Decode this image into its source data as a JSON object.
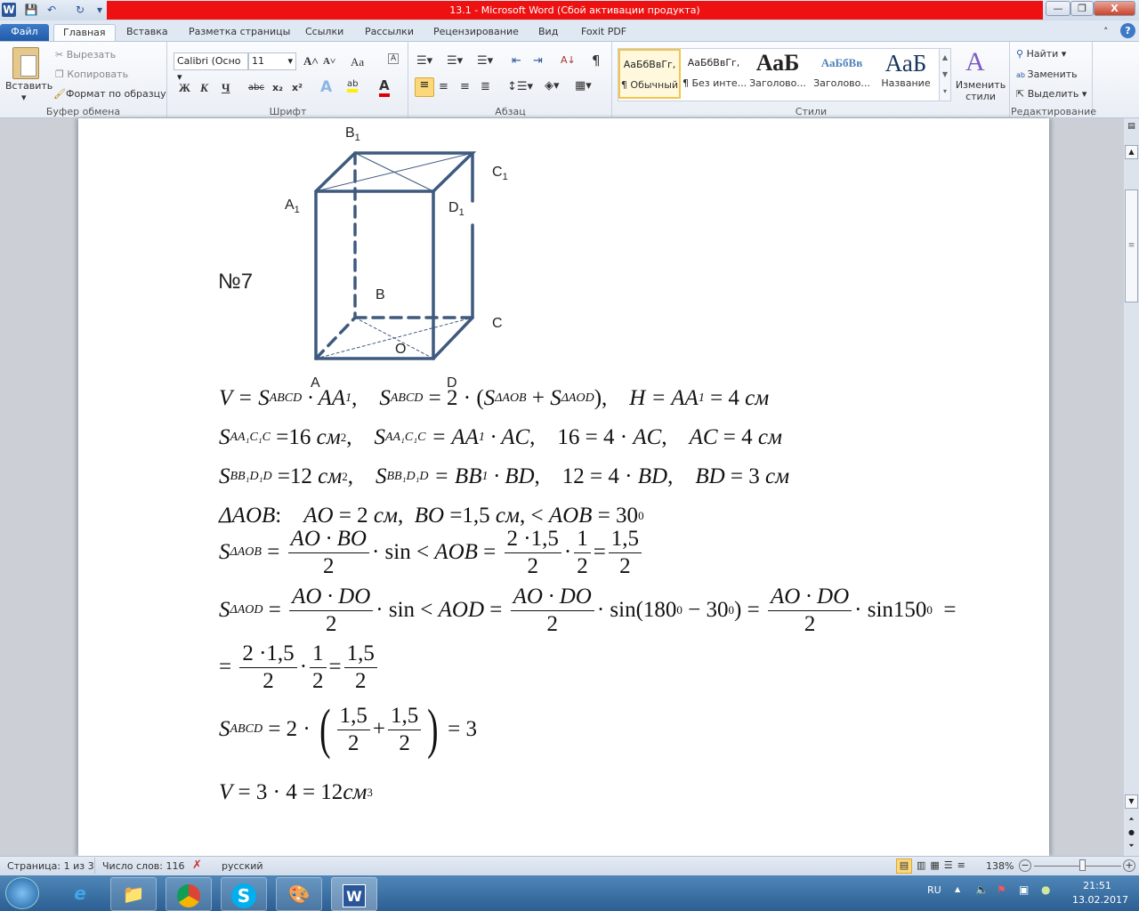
{
  "window": {
    "title": "13.1  -  Microsoft Word (Сбой активации продукта)",
    "minimize": "—",
    "restore": "❐",
    "close": "X"
  },
  "quick_access": {
    "word_icon": "W",
    "save": "💾",
    "undo": "↶",
    "redo": "↻",
    "customize": "▾"
  },
  "tabs": [
    "Файл",
    "Главная",
    "Вставка",
    "Разметка страницы",
    "Ссылки",
    "Рассылки",
    "Рецензирование",
    "Вид",
    "Foxit PDF"
  ],
  "ribbon": {
    "clipboard": {
      "paste": "Вставить",
      "cut": "Вырезать",
      "copy": "Копировать",
      "format_painter": "Формат по образцу",
      "label": "Буфер обмена"
    },
    "font": {
      "font_name": "Calibri (Осно",
      "font_size": "11",
      "grow": "A˄",
      "shrink": "A˅",
      "case": "Aa",
      "clear": "A",
      "bold": "Ж",
      "italic": "К",
      "underline": "Ч",
      "strike": "abc",
      "subscript": "x₂",
      "superscript": "x²",
      "effects": "A",
      "highlight": "ab",
      "color": "A",
      "label": "Шрифт"
    },
    "paragraph": {
      "label": "Абзац",
      "pilcrow": "¶",
      "sort": "А↓"
    },
    "styles": {
      "items": [
        {
          "preview": "АаБбВвГг,",
          "name": "¶ Обычный"
        },
        {
          "preview": "АаБбВвГг,",
          "name": "¶ Без инте..."
        },
        {
          "preview": "АаБ",
          "name": "Заголово..."
        },
        {
          "preview": "АаБбВв",
          "name": "Заголово..."
        },
        {
          "preview": "АаБ",
          "name": "Название"
        }
      ],
      "change_styles": "Изменить стили",
      "label": "Стили"
    },
    "editing": {
      "find": "Найти",
      "replace": "Заменить",
      "select": "Выделить",
      "label": "Редактирование"
    }
  },
  "document": {
    "problem_number": "№7",
    "diagram_labels": {
      "B1": "B",
      "C1": "C",
      "A1": "A",
      "D1": "D",
      "sub1": "1",
      "B": "B",
      "C": "C",
      "O": "O",
      "A": "A",
      "D": "D"
    },
    "formulas": [
      [
        [
          "i",
          "V = S"
        ],
        [
          "sub",
          "ABCD"
        ],
        [
          "i",
          " · AA"
        ],
        [
          "sub",
          "1"
        ],
        [
          "r",
          ",    "
        ],
        [
          "i",
          "S"
        ],
        [
          "sub",
          "ABCD"
        ],
        [
          "r",
          " = 2 · ("
        ],
        [
          "i",
          "S"
        ],
        [
          "sub",
          "ΔAOB"
        ],
        [
          "r",
          " + "
        ],
        [
          "i",
          "S"
        ],
        [
          "sub",
          "ΔAOD"
        ],
        [
          "r",
          "),    "
        ],
        [
          "i",
          "H = AA"
        ],
        [
          "sub",
          "1"
        ],
        [
          "r",
          " = 4 "
        ],
        [
          "i",
          "см"
        ]
      ],
      [
        [
          "i",
          "S"
        ],
        [
          "sub",
          "AA₁C₁C"
        ],
        [
          "r",
          " =16 "
        ],
        [
          "i",
          "см"
        ],
        [
          "sup",
          "2"
        ],
        [
          "r",
          ",    "
        ],
        [
          "i",
          "S"
        ],
        [
          "sub",
          "AA₁C₁C"
        ],
        [
          "i",
          " = AA"
        ],
        [
          "sub",
          "1"
        ],
        [
          "i",
          " · AC"
        ],
        [
          "r",
          ",    16 = 4 · "
        ],
        [
          "i",
          "AC"
        ],
        [
          "r",
          ",    "
        ],
        [
          "i",
          "AC"
        ],
        [
          "r",
          " = 4 "
        ],
        [
          "i",
          "см"
        ]
      ],
      [
        [
          "i",
          "S"
        ],
        [
          "sub",
          "BB₁D₁D"
        ],
        [
          "r",
          " =12 "
        ],
        [
          "i",
          "см"
        ],
        [
          "sup",
          "2"
        ],
        [
          "r",
          ",    "
        ],
        [
          "i",
          "S"
        ],
        [
          "sub",
          "BB₁D₁D"
        ],
        [
          "i",
          " = BB"
        ],
        [
          "sub",
          "1"
        ],
        [
          "i",
          " · BD"
        ],
        [
          "r",
          ",    12 = 4 · "
        ],
        [
          "i",
          "BD"
        ],
        [
          "r",
          ",    "
        ],
        [
          "i",
          "BD"
        ],
        [
          "r",
          " = 3 "
        ],
        [
          "i",
          "см"
        ]
      ],
      [
        [
          "i",
          "ΔAOB"
        ],
        [
          "r",
          ":    "
        ],
        [
          "i",
          "AO"
        ],
        [
          "r",
          " = 2 "
        ],
        [
          "i",
          "см"
        ],
        [
          "r",
          ",  "
        ],
        [
          "i",
          "BO"
        ],
        [
          "r",
          " =1,5 "
        ],
        [
          "i",
          "см"
        ],
        [
          "r",
          ", < "
        ],
        [
          "i",
          "AOB"
        ],
        [
          "r",
          " = 30"
        ],
        [
          "sup",
          "0"
        ]
      ],
      [
        [
          "i",
          "S"
        ],
        [
          "sub",
          "ΔAOB"
        ],
        [
          "r",
          " = "
        ],
        [
          "frac",
          "AO · BO",
          "2"
        ],
        [
          "r",
          "· sin < "
        ],
        [
          "i",
          "AOB"
        ],
        [
          "r",
          " = "
        ],
        [
          "frac",
          "2 ·1,5",
          "2"
        ],
        [
          "r",
          "·"
        ],
        [
          "frac",
          "1",
          "2"
        ],
        [
          "r",
          "="
        ],
        [
          "frac",
          "1,5",
          "2"
        ]
      ],
      [
        [
          "i",
          "S"
        ],
        [
          "sub",
          "ΔAOD"
        ],
        [
          "r",
          " = "
        ],
        [
          "frac",
          "AO · DO",
          "2"
        ],
        [
          "r",
          "· sin < "
        ],
        [
          "i",
          "AOD"
        ],
        [
          "r",
          " = "
        ],
        [
          "frac",
          "AO · DO",
          "2"
        ],
        [
          "r",
          "· sin(180"
        ],
        [
          "sup",
          "0"
        ],
        [
          "r",
          " − 30"
        ],
        [
          "sup",
          "0"
        ],
        [
          "r",
          ") = "
        ],
        [
          "frac",
          "AO · DO",
          "2"
        ],
        [
          "r",
          "· sin150"
        ],
        [
          "sup",
          "0"
        ],
        [
          "r",
          "  ="
        ]
      ],
      [
        [
          "r",
          "= "
        ],
        [
          "frac",
          "2 ·1,5",
          "2"
        ],
        [
          "r",
          "·"
        ],
        [
          "frac",
          "1",
          "2"
        ],
        [
          "r",
          "="
        ],
        [
          "frac",
          "1,5",
          "2"
        ]
      ],
      [
        [
          "i",
          "S"
        ],
        [
          "sub",
          "ABCD"
        ],
        [
          "r",
          " = 2 · "
        ],
        [
          "lp",
          "("
        ],
        [
          "frac",
          "1,5",
          "2"
        ],
        [
          "r",
          "+"
        ],
        [
          "frac",
          "1,5",
          "2"
        ],
        [
          "rp",
          ")"
        ],
        [
          "r",
          " = 3"
        ]
      ],
      [
        [
          "i",
          "V"
        ],
        [
          "r",
          " = 3 · 4 = 12"
        ],
        [
          "i",
          "см"
        ],
        [
          "sup",
          "3"
        ]
      ]
    ]
  },
  "statusbar": {
    "page": "Страница: 1 из 3",
    "words": "Число слов: 116",
    "language": "русский",
    "zoom": "138%",
    "zoom_level_percent": 138
  },
  "taskbar": {
    "lang": "RU",
    "time": "21:51",
    "date": "13.02.2017"
  },
  "colors": {
    "title_red": "#ee1111",
    "diagram_line": "#3f5a7f"
  }
}
